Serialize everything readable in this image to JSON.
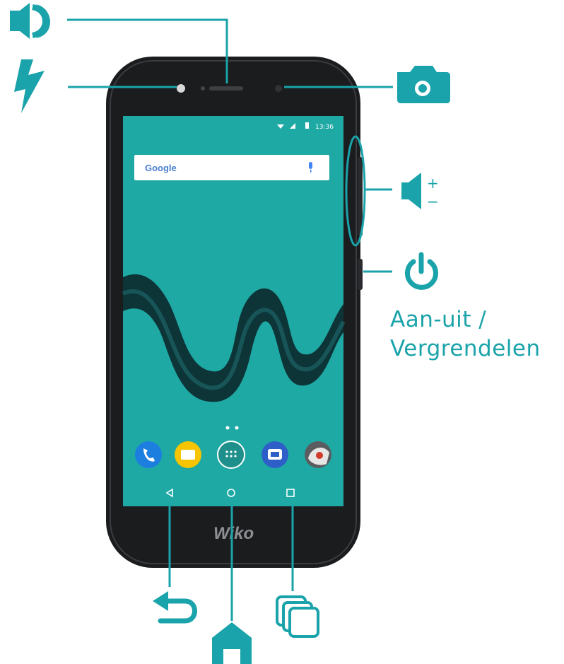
{
  "colors": {
    "accent": "#1aa3aa",
    "phone_body": "#1b1c1e",
    "screen_teal": "#1fa9a5"
  },
  "phone": {
    "brand": "Wiko",
    "status_time": "13:36",
    "search_bar": {
      "text": "Google",
      "icon": "microphone-icon"
    },
    "page_dots": 2,
    "dock_apps": [
      "phone-app-icon",
      "messages-app-icon",
      "app-drawer-icon",
      "sms-app-icon",
      "camera-app-icon"
    ],
    "nav_keys": [
      "back-key",
      "home-key",
      "recent-apps-key"
    ]
  },
  "callouts": {
    "speaker": {
      "icon": "speaker-icon"
    },
    "flash": {
      "icon": "flash-icon"
    },
    "front_camera": {
      "icon": "camera-icon"
    },
    "volume": {
      "icon": "volume-plus-minus-icon",
      "plus": "+",
      "minus": "−"
    },
    "power": {
      "icon": "power-icon",
      "label_line1": "Aan-uit /",
      "label_line2": "Vergrendelen"
    },
    "back": {
      "icon": "back-arrow-icon"
    },
    "home": {
      "icon": "home-icon"
    },
    "recent": {
      "icon": "recent-apps-icon"
    }
  }
}
